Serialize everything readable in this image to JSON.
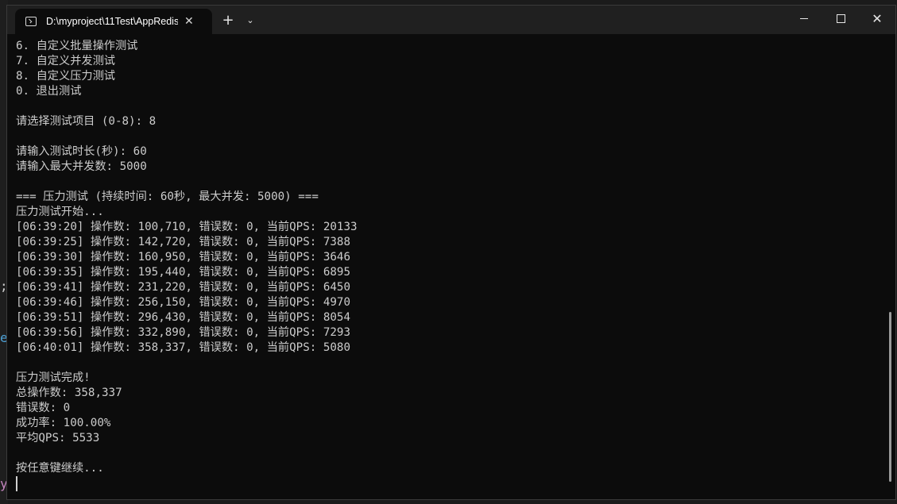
{
  "background": {
    "glyphs": [
      ";",
      "e",
      "y"
    ]
  },
  "window": {
    "tab_title": "D:\\myproject\\11Test\\AppRedis",
    "tab_close": "✕",
    "new_tab": "+",
    "dropdown": "⌄",
    "close_symbol": "✕"
  },
  "terminal": {
    "lines": [
      "6. 自定义批量操作测试",
      "7. 自定义并发测试",
      "8. 自定义压力测试",
      "0. 退出测试",
      "",
      "请选择测试项目 (0-8): 8",
      "",
      "请输入测试时长(秒): 60",
      "请输入最大并发数: 5000",
      "",
      "=== 压力测试 (持续时间: 60秒, 最大并发: 5000) ===",
      "压力测试开始...",
      "[06:39:20] 操作数: 100,710, 错误数: 0, 当前QPS: 20133",
      "[06:39:25] 操作数: 142,720, 错误数: 0, 当前QPS: 7388",
      "[06:39:30] 操作数: 160,950, 错误数: 0, 当前QPS: 3646",
      "[06:39:35] 操作数: 195,440, 错误数: 0, 当前QPS: 6895",
      "[06:39:41] 操作数: 231,220, 错误数: 0, 当前QPS: 6450",
      "[06:39:46] 操作数: 256,150, 错误数: 0, 当前QPS: 4970",
      "[06:39:51] 操作数: 296,430, 错误数: 0, 当前QPS: 8054",
      "[06:39:56] 操作数: 332,890, 错误数: 0, 当前QPS: 7293",
      "[06:40:01] 操作数: 358,337, 错误数: 0, 当前QPS: 5080",
      "",
      "压力测试完成!",
      "总操作数: 358,337",
      "错误数: 0",
      "成功率: 100.00%",
      "平均QPS: 5533",
      "",
      "按任意键继续..."
    ]
  }
}
